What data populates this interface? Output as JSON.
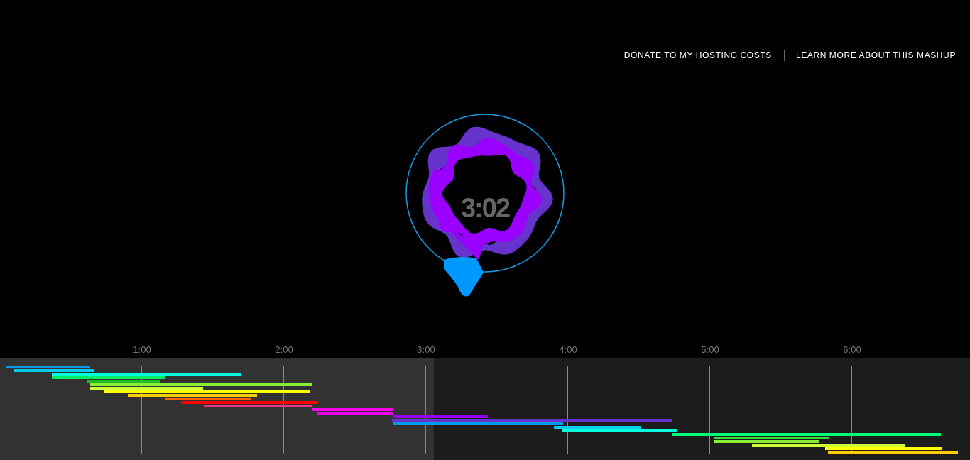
{
  "header_links": [
    {
      "label": "DONATE TO MY HOSTING COSTS"
    },
    {
      "label": "LEARN MORE ABOUT THIS MASHUP"
    }
  ],
  "player": {
    "time": "3:02"
  },
  "timeline": {
    "ticks": [
      "1:00",
      "2:00",
      "3:00",
      "4:00",
      "5:00",
      "6:00"
    ],
    "level": 0.447
  }
}
